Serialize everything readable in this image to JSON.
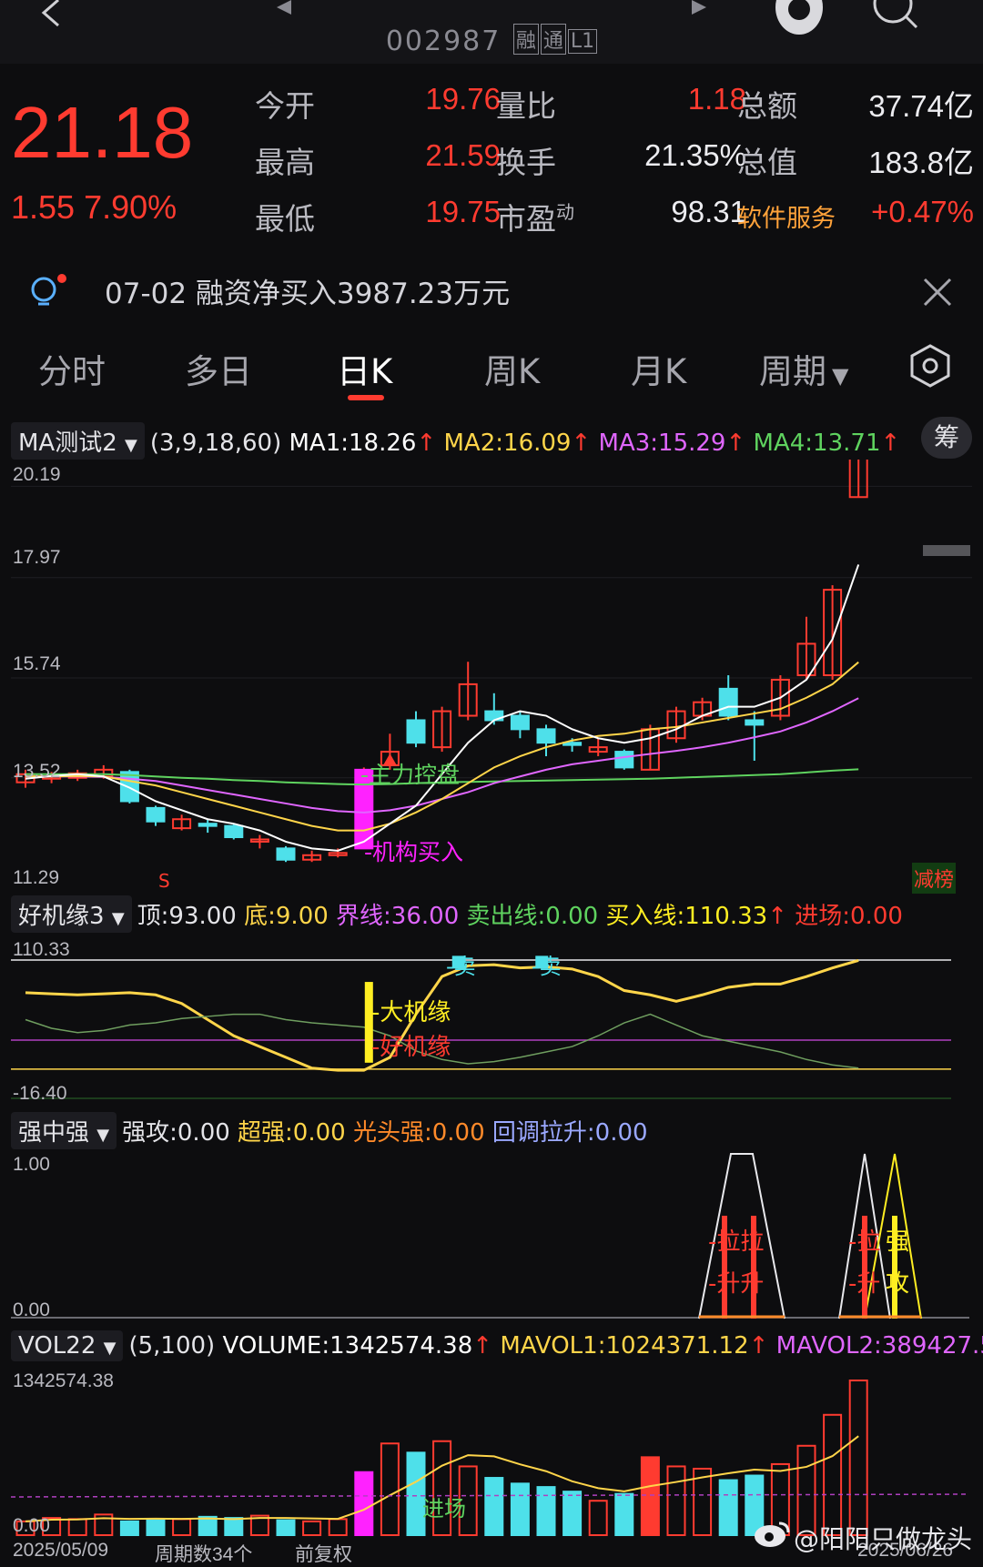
{
  "header": {
    "stock_code": "002987",
    "tags": [
      "融",
      "通",
      "L1"
    ],
    "back_icon": "chevron-left-icon",
    "prev_icon": "triangle-left-icon",
    "next_icon": "triangle-right-icon",
    "assistant_icon": "assistant-icon",
    "search_icon": "search-icon"
  },
  "quote": {
    "price": "21.18",
    "change": "1.55",
    "change_pct": "7.90%",
    "stats": [
      {
        "label": "今开",
        "value": "19.76"
      },
      {
        "label": "量比",
        "value": "1.18"
      },
      {
        "label": "总额",
        "value": "37.74亿"
      },
      {
        "label": "最高",
        "value": "21.59"
      },
      {
        "label": "换手",
        "value": "21.35%"
      },
      {
        "label": "总值",
        "value": "183.8亿"
      },
      {
        "label": "最低",
        "value": "19.75"
      },
      {
        "label": "市盈",
        "sup": "动",
        "value": "98.31"
      },
      {
        "label": "软件服务",
        "value": "+0.47%"
      }
    ]
  },
  "notice": {
    "text": "07-02 融资净买入3987.23万元",
    "close_icon": "close-icon",
    "bulb_icon": "lightbulb-icon"
  },
  "tabs": [
    "分时",
    "多日",
    "日K",
    "周K",
    "月K",
    "周期"
  ],
  "active_tab": "日K",
  "settings_icon": "hexagon-settings-icon",
  "main_chart": {
    "indicator": "MA测试2",
    "params": "(3,9,18,60)",
    "ma1": "MA1:18.26",
    "ma2": "MA2:16.09",
    "ma3": "MA3:15.29",
    "ma4": "MA4:13.71",
    "ma5_cut": "ᛁ",
    "chip_label": "筹",
    "y_labels": [
      "20.19",
      "17.97",
      "15.74",
      "13.52",
      "11.29"
    ],
    "annotations": {
      "zhuli": "-主力控盘",
      "jigou": "-机构买入",
      "s_mark": "S",
      "jianbang": "减榜"
    }
  },
  "chart_data": [
    {
      "type": "candlestick",
      "title": "MA测试2",
      "ylim": [
        11.29,
        20.19
      ],
      "candles": [
        {
          "o": 13.42,
          "c": 13.6,
          "h": 13.7,
          "l": 13.3
        },
        {
          "o": 13.5,
          "c": 13.55,
          "h": 13.65,
          "l": 13.4
        },
        {
          "o": 13.52,
          "c": 13.62,
          "h": 13.7,
          "l": 13.45
        },
        {
          "o": 13.55,
          "c": 13.7,
          "h": 13.8,
          "l": 13.5
        },
        {
          "o": 13.65,
          "c": 13.0,
          "h": 13.7,
          "l": 12.95
        },
        {
          "o": 12.85,
          "c": 12.55,
          "h": 12.9,
          "l": 12.45
        },
        {
          "o": 12.4,
          "c": 12.6,
          "h": 12.7,
          "l": 12.35
        },
        {
          "o": 12.5,
          "c": 12.45,
          "h": 12.6,
          "l": 12.3
        },
        {
          "o": 12.45,
          "c": 12.2,
          "h": 12.5,
          "l": 12.15
        },
        {
          "o": 12.1,
          "c": 12.15,
          "h": 12.25,
          "l": 11.95
        },
        {
          "o": 11.95,
          "c": 11.7,
          "h": 12.0,
          "l": 11.65
        },
        {
          "o": 11.7,
          "c": 11.8,
          "h": 11.9,
          "l": 11.65
        },
        {
          "o": 11.8,
          "c": 11.85,
          "h": 11.95,
          "l": 11.75
        },
        {
          "o": 11.95,
          "c": 13.7,
          "h": 13.75,
          "l": 11.95
        },
        {
          "o": 13.8,
          "c": 14.1,
          "h": 14.5,
          "l": 13.7
        },
        {
          "o": 14.8,
          "c": 14.3,
          "h": 15.0,
          "l": 14.2
        },
        {
          "o": 14.2,
          "c": 15.0,
          "h": 15.1,
          "l": 14.1
        },
        {
          "o": 14.9,
          "c": 15.6,
          "h": 16.1,
          "l": 14.8
        },
        {
          "o": 15.0,
          "c": 14.8,
          "h": 15.4,
          "l": 14.7
        },
        {
          "o": 14.9,
          "c": 14.6,
          "h": 15.0,
          "l": 14.4
        },
        {
          "o": 14.6,
          "c": 14.3,
          "h": 14.7,
          "l": 14.0
        },
        {
          "o": 14.3,
          "c": 14.25,
          "h": 14.4,
          "l": 14.1
        },
        {
          "o": 14.1,
          "c": 14.2,
          "h": 14.4,
          "l": 14.0
        },
        {
          "o": 14.1,
          "c": 13.75,
          "h": 14.15,
          "l": 13.7
        },
        {
          "o": 13.7,
          "c": 14.6,
          "h": 14.7,
          "l": 13.7
        },
        {
          "o": 14.4,
          "c": 15.0,
          "h": 15.1,
          "l": 14.3
        },
        {
          "o": 14.9,
          "c": 15.2,
          "h": 15.3,
          "l": 14.8
        },
        {
          "o": 15.5,
          "c": 14.9,
          "h": 15.8,
          "l": 14.8
        },
        {
          "o": 14.8,
          "c": 14.7,
          "h": 15.0,
          "l": 13.9
        },
        {
          "o": 14.9,
          "c": 15.7,
          "h": 15.8,
          "l": 14.8
        },
        {
          "o": 15.8,
          "c": 16.5,
          "h": 17.1,
          "l": 15.7
        },
        {
          "o": 15.8,
          "c": 17.7,
          "h": 17.8,
          "l": 15.7
        },
        {
          "o": 19.76,
          "c": 21.18,
          "h": 21.59,
          "l": 19.75
        }
      ],
      "ma1": [
        13.5,
        13.56,
        13.6,
        13.55,
        13.3,
        13.0,
        12.8,
        12.6,
        12.5,
        12.35,
        12.1,
        11.95,
        11.9,
        12.1,
        12.5,
        12.9,
        13.6,
        14.3,
        14.8,
        15.0,
        14.9,
        14.6,
        14.4,
        14.3,
        14.4,
        14.6,
        14.9,
        15.1,
        15.1,
        15.3,
        15.7,
        16.6,
        18.26
      ],
      "ma2": [
        13.55,
        13.55,
        13.56,
        13.55,
        13.45,
        13.35,
        13.2,
        13.05,
        12.9,
        12.75,
        12.6,
        12.45,
        12.35,
        12.35,
        12.5,
        12.75,
        13.05,
        13.4,
        13.75,
        14.0,
        14.2,
        14.35,
        14.45,
        14.5,
        14.6,
        14.65,
        14.75,
        14.85,
        14.95,
        15.05,
        15.3,
        15.6,
        16.09
      ],
      "ma3": [
        13.55,
        13.55,
        13.55,
        13.54,
        13.5,
        13.45,
        13.35,
        13.25,
        13.15,
        13.05,
        12.95,
        12.85,
        12.78,
        12.75,
        12.8,
        12.9,
        13.05,
        13.2,
        13.4,
        13.55,
        13.7,
        13.82,
        13.9,
        13.98,
        14.05,
        14.12,
        14.2,
        14.3,
        14.42,
        14.55,
        14.75,
        15.0,
        15.29
      ],
      "ma4": [
        13.6,
        13.6,
        13.6,
        13.6,
        13.58,
        13.55,
        13.52,
        13.5,
        13.47,
        13.45,
        13.42,
        13.4,
        13.38,
        13.37,
        13.38,
        13.4,
        13.42,
        13.43,
        13.44,
        13.45,
        13.46,
        13.47,
        13.48,
        13.49,
        13.5,
        13.52,
        13.54,
        13.56,
        13.58,
        13.6,
        13.64,
        13.68,
        13.71
      ]
    },
    {
      "type": "line",
      "title": "好机缘3",
      "ylim": [
        -16.4,
        110.33
      ],
      "series": [
        {
          "name": "买入线",
          "values": [
            80,
            79,
            78,
            79,
            80,
            78,
            70,
            55,
            40,
            30,
            20,
            10,
            8,
            8,
            20,
            60,
            95,
            105,
            106,
            103,
            104,
            102,
            95,
            82,
            78,
            72,
            78,
            85,
            88,
            88,
            95,
            103,
            110
          ]
        },
        {
          "name": "卖出线",
          "values": [
            55,
            47,
            43,
            45,
            50,
            52,
            56,
            58,
            60,
            60,
            55,
            52,
            50,
            48,
            40,
            26,
            18,
            14,
            16,
            20,
            25,
            30,
            40,
            52,
            60,
            50,
            40,
            35,
            30,
            25,
            18,
            13,
            10
          ]
        }
      ]
    },
    {
      "type": "bar",
      "title": "VOL22",
      "ylim": [
        0,
        1342574.38
      ],
      "values": [
        12,
        15,
        14,
        18,
        12,
        13,
        14,
        16,
        15,
        17,
        13,
        12,
        14,
        55,
        80,
        72,
        82,
        60,
        50,
        45,
        42,
        38,
        30,
        36,
        68,
        60,
        58,
        48,
        52,
        62,
        78,
        105,
        135
      ]
    }
  ],
  "osc_panel": {
    "indicator": "好机缘3",
    "top": "顶:93.00",
    "bottom": "底:9.00",
    "boundary": "界线:36.00",
    "sell": "卖出线:0.00",
    "buy": "买入线:110.33",
    "enter": "进场:0.00",
    "y_top": "110.33",
    "y_bottom": "-16.40",
    "marks": {
      "mai1": "-卖",
      "mai2": "-卖",
      "daji": "-大机缘",
      "haoji": "-好机缘"
    }
  },
  "strength_panel": {
    "indicator": "强中强",
    "qianggong": "强攻:0.00",
    "chaoqiang": "超强:0.00",
    "guangtou": "光头强:0.00",
    "huitiao": "回调拉升:0.00",
    "y_top": "1.00",
    "y_bottom": "0.00",
    "marks": {
      "la1": "-拉拉",
      "sheng1": "-升升",
      "la2": "-拉",
      "sheng2": "-升",
      "qiang": "强",
      "gong": "攻"
    }
  },
  "vol_panel": {
    "indicator": "VOL22",
    "params": "(5,100)",
    "volume": "VOLUME:1342574.38",
    "mavol1": "MAVOL1:1024371.12",
    "mavol2": "MAVOL2:389427.5",
    "y_top": "1342574.38",
    "y_bottom": "0.00",
    "entry_mark": "进场"
  },
  "footer": {
    "start_date": "2025/05/09",
    "period_count": "周期数34个",
    "adjust": "前复权",
    "end_date": "2025/06/26",
    "watermark": "@阳阳只做龙头"
  },
  "colors": {
    "up": "#ff3b30",
    "down": "#4ee0ea",
    "ma1": "#ffffff",
    "ma2": "#ffd54a",
    "ma3": "#e066ff",
    "ma4": "#5fd35f",
    "magenta": "#ff22ff",
    "yellow": "#ffee22"
  }
}
